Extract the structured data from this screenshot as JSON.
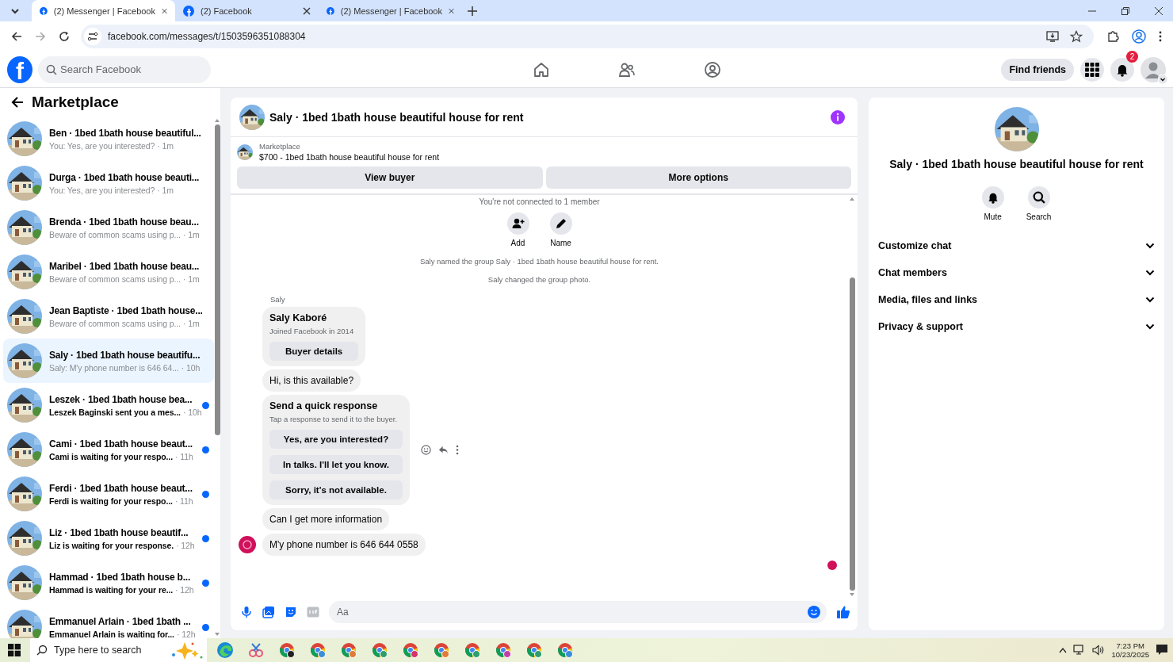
{
  "browser": {
    "tabs": [
      {
        "title": "(2) Messenger | Facebook",
        "selected": true
      },
      {
        "title": "(2) Facebook",
        "selected": false
      },
      {
        "title": "(2) Messenger | Facebook",
        "selected": false
      }
    ],
    "url": "facebook.com/messages/t/1503596351088304"
  },
  "header": {
    "logo": "f",
    "search": {
      "placeholder": "Search Facebook"
    },
    "find_friends": "Find friends",
    "notification_count": "2"
  },
  "sidebar": {
    "title": "Marketplace",
    "conversations": [
      {
        "name": "Ben · 1bed 1bath house beautiful...",
        "preview": "You: Yes, are you interested?",
        "time": "· 1m",
        "unread": false,
        "selected": false
      },
      {
        "name": "Durga · 1bed 1bath house beauti...",
        "preview": "You: Yes, are you interested?",
        "time": "· 1m",
        "unread": false,
        "selected": false
      },
      {
        "name": "Brenda · 1bed 1bath house beau...",
        "preview": "Beware of common scams using p...",
        "time": "· 1m",
        "unread": false,
        "selected": false
      },
      {
        "name": "Maribel · 1bed 1bath house beau...",
        "preview": "Beware of common scams using p...",
        "time": "· 1m",
        "unread": false,
        "selected": false
      },
      {
        "name": "Jean Baptiste · 1bed 1bath house...",
        "preview": "Beware of common scams using p...",
        "time": "· 1m",
        "unread": false,
        "selected": false
      },
      {
        "name": "Saly · 1bed 1bath house beautifu...",
        "preview": "Saly: M'y phone number is 646 64...",
        "time": "· 10h",
        "unread": false,
        "selected": true
      },
      {
        "name": "Leszek · 1bed 1bath house bea...",
        "preview": "Leszek Baginski sent you a mes...",
        "time": "· 10h",
        "unread": true,
        "selected": false
      },
      {
        "name": "Cami · 1bed 1bath house beaut...",
        "preview": "Cami is waiting for your respo...",
        "time": "· 11h",
        "unread": true,
        "selected": false
      },
      {
        "name": "Ferdi · 1bed 1bath house beaut...",
        "preview": "Ferdi is waiting for your respo...",
        "time": "· 11h",
        "unread": true,
        "selected": false
      },
      {
        "name": "Liz · 1bed 1bath house beautif...",
        "preview": "Liz is waiting for your response.",
        "time": "· 12h",
        "unread": true,
        "selected": false
      },
      {
        "name": "Hammad · 1bed 1bath house b...",
        "preview": "Hammad is waiting for your re...",
        "time": "· 12h",
        "unread": true,
        "selected": false
      },
      {
        "name": "Emmanuel Arlain · 1bed 1bath ...",
        "preview": "Emmanuel Arlain is waiting for...",
        "time": "· 12h",
        "unread": true,
        "selected": false
      }
    ]
  },
  "chat": {
    "title": "Saly · 1bed 1bath house beautiful house for rent",
    "listing": {
      "label": "Marketplace",
      "text": "$700 - 1bed 1bath house beautiful house for rent"
    },
    "buttons": [
      "View buyer",
      "More options"
    ],
    "notice": "You're not connected to 1 member",
    "actions": [
      "Add",
      "Name"
    ],
    "events": [
      "Saly named the group Saly · 1bed 1bath house beautiful house for rent.",
      "Saly changed the group photo."
    ],
    "sender": "Saly",
    "messages": [
      {
        "kind": "profile_card",
        "name": "Saly Kaboré",
        "detail": "Joined Facebook in 2014",
        "button": "Buyer details",
        "hovered": false,
        "show_avatar": false
      },
      {
        "kind": "text",
        "text": "Hi, is this available?",
        "hovered": false,
        "show_avatar": false
      },
      {
        "kind": "quick_response",
        "title": "Send a quick response",
        "subtitle": "Tap a response to send it to the buyer.",
        "options": [
          "Yes, are you interested?",
          "In talks. I'll let you know.",
          "Sorry, it's not available."
        ],
        "hovered": true,
        "show_avatar": false
      },
      {
        "kind": "text",
        "text": "Can I get more information",
        "hovered": false,
        "show_avatar": false
      },
      {
        "kind": "text",
        "text": "M'y phone number is 646 644 0558",
        "hovered": false,
        "show_avatar": true
      }
    ],
    "seen": true,
    "composer": {
      "placeholder": "Aa"
    }
  },
  "details": {
    "title": "Saly · 1bed 1bath house beautiful house for rent",
    "actions": [
      {
        "kind": "mute",
        "label": "Mute"
      },
      {
        "kind": "search",
        "label": "Search"
      }
    ],
    "sections": [
      "Customize chat",
      "Chat members",
      "Media, files and links",
      "Privacy & support"
    ]
  },
  "taskbar": {
    "search": {
      "placeholder": "Type here to search"
    },
    "time": "7:23 PM",
    "date": "10/23/2025"
  }
}
